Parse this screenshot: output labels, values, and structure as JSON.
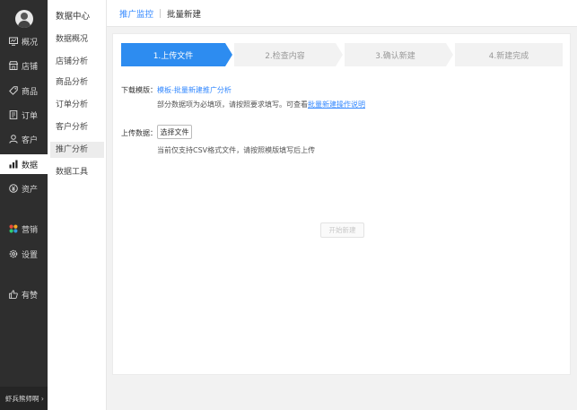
{
  "nav": {
    "items": [
      {
        "label": "概况",
        "icon": "overview-icon"
      },
      {
        "label": "店铺",
        "icon": "store-icon"
      },
      {
        "label": "商品",
        "icon": "tag-icon"
      },
      {
        "label": "订单",
        "icon": "order-icon"
      },
      {
        "label": "客户",
        "icon": "user-icon"
      },
      {
        "label": "数据",
        "icon": "bar-chart-icon"
      },
      {
        "label": "资产",
        "icon": "asset-icon"
      },
      {
        "label": "营销",
        "icon": "apps-icon"
      },
      {
        "label": "设置",
        "icon": "gear-icon"
      },
      {
        "label": "有赞",
        "icon": "thumb-up-icon"
      }
    ],
    "active": "数据",
    "footer": "虾兵熊师啊 ›"
  },
  "subnav": {
    "title": "数据中心",
    "items": [
      "数据概况",
      "店铺分析",
      "商品分析",
      "订单分析",
      "客户分析",
      "推广分析",
      "数据工具"
    ],
    "active": "推广分析"
  },
  "breadcrumb": {
    "parent": "推广监控",
    "current": "批量新建"
  },
  "steps": [
    "1.上传文件",
    "2.检查内容",
    "3.确认新建",
    "4.新建完成"
  ],
  "template_row": {
    "label": "下载模版：",
    "link": "模板-批量新建推广分析",
    "note_prefix": "部分数据项为必填项，请按照要求填写。可查看",
    "note_link": "批量新建操作说明"
  },
  "upload_row": {
    "label": "上传数据：",
    "button": "选择文件",
    "note": "当前仅支持CSV格式文件，请按照模版填写后上传"
  },
  "start_button": "开始新建",
  "colors": {
    "accent": "#2d8cf0",
    "link": "#3388ff",
    "nav_bg": "#2e2e2e"
  }
}
